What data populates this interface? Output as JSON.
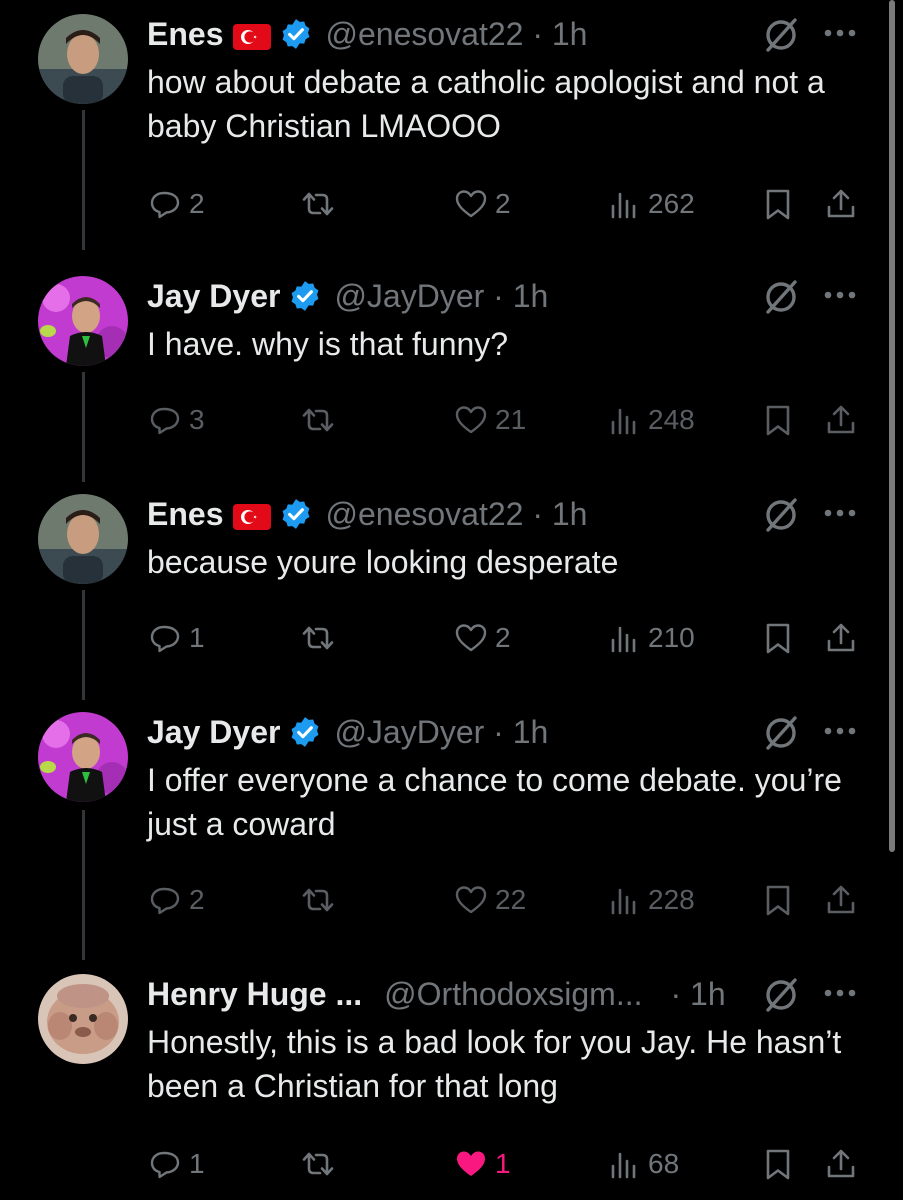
{
  "tweets": [
    {
      "author": "Enes",
      "has_flag": true,
      "handle": "@enesovat22 · 1h",
      "text": "how about debate a catholic apologist and not a baby Christian LMAOOO",
      "replies": "2",
      "likes": "2",
      "views": "262",
      "liked": false
    },
    {
      "author": "Jay Dyer",
      "has_flag": false,
      "handle": "@JayDyer · 1h",
      "text": "I have. why is that funny?",
      "replies": "3",
      "likes": "21",
      "views": "248",
      "liked": false
    },
    {
      "author": "Enes",
      "has_flag": true,
      "handle": "@enesovat22 · 1h",
      "text": "because youre looking desperate",
      "replies": "1",
      "likes": "2",
      "views": "210",
      "liked": false
    },
    {
      "author": "Jay Dyer",
      "has_flag": false,
      "handle": "@JayDyer · 1h",
      "text": "I offer everyone a chance to come debate. you’re just a coward",
      "replies": "2",
      "likes": "22",
      "views": "228",
      "liked": false
    },
    {
      "author": "Henry Huge ...",
      "has_flag": false,
      "handle": "@Orthodoxsigm...",
      "time": "· 1h",
      "text": "Honestly, this is a bad look for you Jay. He hasn’t been a Christian for that long",
      "replies": "1",
      "likes": "1",
      "views": "68",
      "liked": true
    }
  ],
  "colors": {
    "background": "#000000",
    "text": "#e7e9ea",
    "secondary": "#71767b",
    "verified": "#1d9bf0",
    "like": "#f91880",
    "flag": "#e30a17"
  }
}
